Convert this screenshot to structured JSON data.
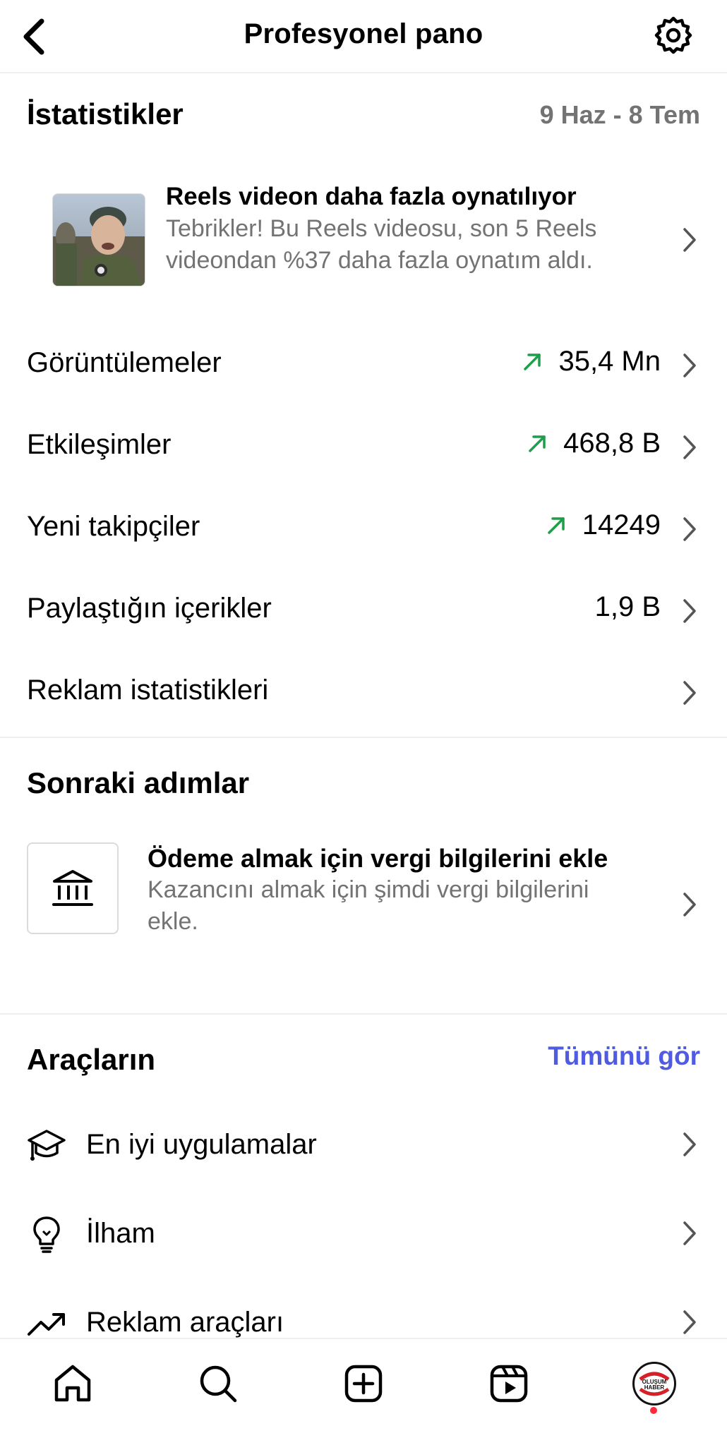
{
  "header": {
    "title": "Profesyonel pano",
    "back_icon": "chevron-left-icon",
    "settings_icon": "gear-icon"
  },
  "statistics": {
    "title": "İstatistikler",
    "date_range": "9 Haz - 8 Tem",
    "reels_card": {
      "title": "Reels videon daha fazla oynatılıyor",
      "description": "Tebrikler! Bu Reels videosu, son 5 Reels videondan %37 daha fazla oynatım aldı."
    },
    "rows": [
      {
        "label": "Görüntülemeler",
        "value": "35,4 Mn",
        "trend": "up"
      },
      {
        "label": "Etkileşimler",
        "value": "468,8 B",
        "trend": "up"
      },
      {
        "label": "Yeni takipçiler",
        "value": "14249",
        "trend": "up"
      },
      {
        "label": "Paylaştığın içerikler",
        "value": "1,9 B",
        "trend": ""
      },
      {
        "label": "Reklam istatistikleri",
        "value": "",
        "trend": ""
      }
    ]
  },
  "next_steps": {
    "title": "Sonraki adımlar",
    "tax_card": {
      "icon": "bank-icon",
      "title": "Ödeme almak için vergi bilgilerini ekle",
      "description": "Kazancını almak için şimdi vergi bilgilerini ekle."
    }
  },
  "tools": {
    "title": "Araçların",
    "see_all": "Tümünü gör",
    "items": [
      {
        "label": "En iyi uygulamalar",
        "icon": "graduation-cap-icon"
      },
      {
        "label": "İlham",
        "icon": "lightbulb-icon"
      },
      {
        "label": "Reklam araçları",
        "icon": "trending-up-icon"
      }
    ]
  },
  "tabbar": {
    "items": [
      "home-icon",
      "search-icon",
      "create-icon",
      "reels-icon",
      "profile-avatar"
    ],
    "avatar_text_top": "OLUŞUM",
    "avatar_text_bottom": "HABER"
  },
  "colors": {
    "accent_link": "#4f5be0",
    "trend_green": "#1e9e4a",
    "secondary_text": "#737373",
    "notification": "#ff2a3a"
  }
}
